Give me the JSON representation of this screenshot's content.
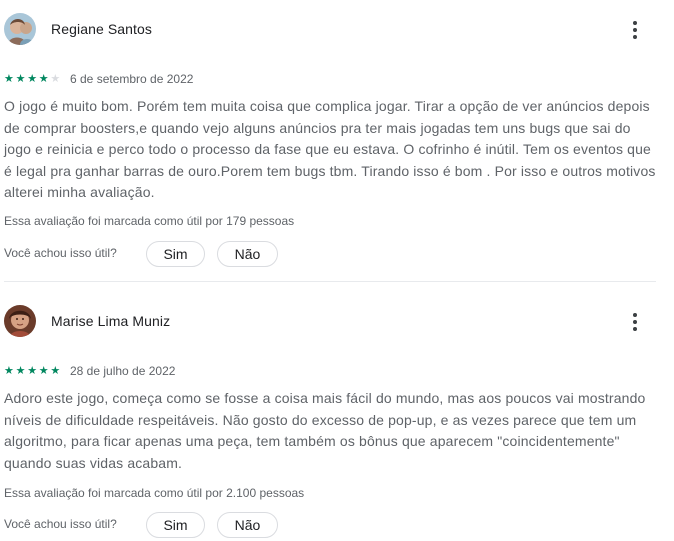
{
  "reviews": [
    {
      "author": "Regiane Santos",
      "rating": 4,
      "max_rating": 5,
      "date": "6 de setembro de 2022",
      "text": "O jogo é muito bom. Porém tem muita coisa que complica jogar. Tirar a opção de ver anúncios depois de comprar boosters,e quando vejo alguns anúncios pra ter mais jogadas tem uns bugs que sai do jogo e reinicia e perco todo o processo da fase que eu estava. O cofrinho é inútil. Tem os eventos que é legal pra ganhar barras de ouro.Porem tem bugs tbm. Tirando isso é bom . Por isso e outros motivos alterei minha avaliação.",
      "helpful_count_text": "Essa avaliação foi marcada como útil por 179 pessoas"
    },
    {
      "author": "Marise Lima Muniz",
      "rating": 5,
      "max_rating": 5,
      "date": "28 de julho de 2022",
      "text": "Adoro este jogo, começa como se fosse a coisa mais fácil do mundo, mas aos poucos vai mostrando níveis de dificuldade respeitáveis. Não gosto do excesso de pop-up, e as vezes parece que tem um algoritmo, para ficar apenas uma peça, tem também os bônus que aparecem \"coincidentemente\" quando suas vidas acabam.",
      "helpful_count_text": "Essa avaliação foi marcada como útil por 2.100 pessoas"
    }
  ],
  "helpful_prompt": "Você achou isso útil?",
  "yes_label": "Sim",
  "no_label": "Não",
  "colors": {
    "star_filled": "#01875f",
    "star_empty": "#dadce0",
    "secondary_text": "#5f6368",
    "primary_text": "#202124",
    "border": "#dadce0"
  },
  "icons": {
    "rating": "star-icon",
    "menu": "more-vert-icon"
  }
}
